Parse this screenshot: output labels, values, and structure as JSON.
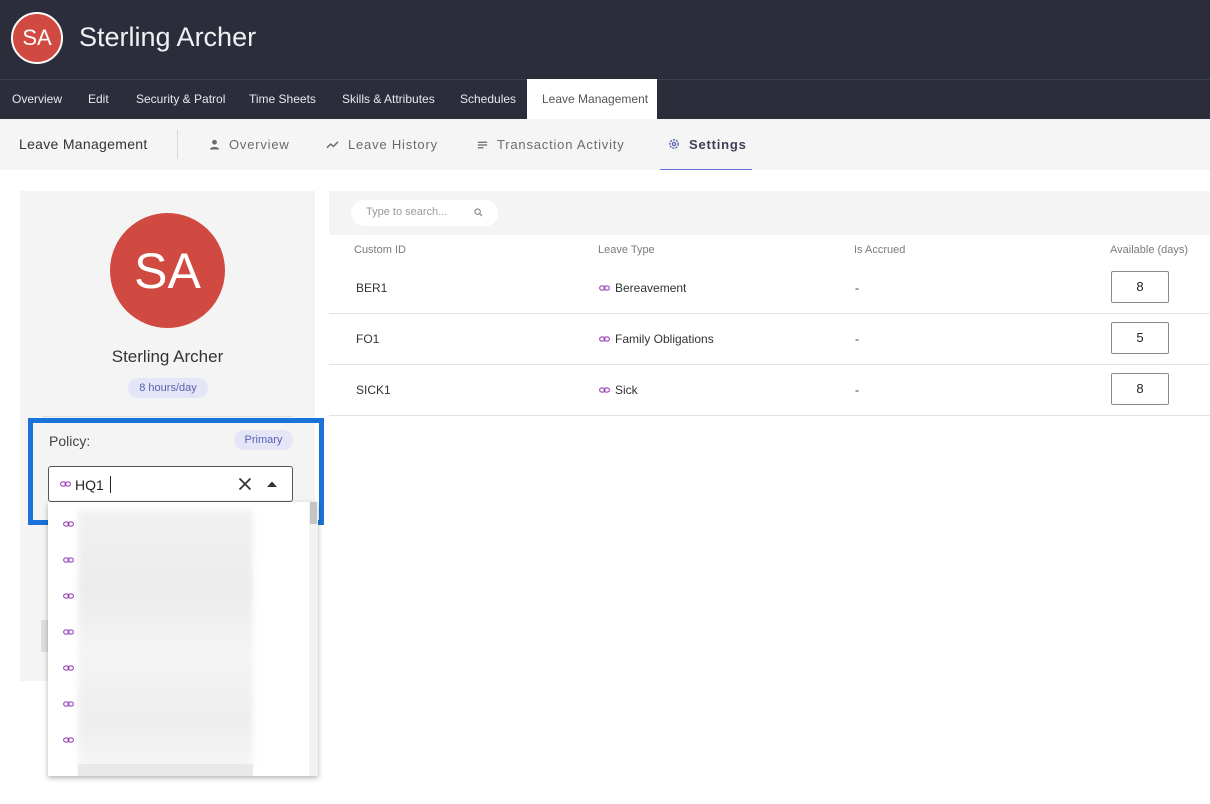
{
  "header": {
    "avatar_initials": "SA",
    "user_name": "Sterling Archer"
  },
  "tabs": [
    {
      "label": "Overview"
    },
    {
      "label": "Edit"
    },
    {
      "label": "Security & Patrol"
    },
    {
      "label": "Time Sheets"
    },
    {
      "label": "Skills & Attributes"
    },
    {
      "label": "Schedules"
    },
    {
      "label": "Leave Management",
      "active": true
    }
  ],
  "subnav": {
    "title": "Leave Management",
    "tabs": [
      {
        "label": "Overview",
        "icon": "person-icon"
      },
      {
        "label": "Leave History",
        "icon": "trend-icon"
      },
      {
        "label": "Transaction Activity",
        "icon": "notes-icon"
      },
      {
        "label": "Settings",
        "icon": "gear-icon",
        "active": true
      }
    ]
  },
  "profile": {
    "avatar_initials": "SA",
    "name": "Sterling Archer",
    "hours_badge": "8 hours/day",
    "policy_label": "Policy:",
    "primary_badge": "Primary",
    "policy_value": "HQ1"
  },
  "search": {
    "placeholder": "Type to search..."
  },
  "table": {
    "columns": [
      "Custom ID",
      "Leave Type",
      "Is Accrued",
      "Available (days)"
    ],
    "rows": [
      {
        "custom_id": "BER1",
        "leave_type": "Bereavement",
        "is_accrued": "-",
        "available": "8"
      },
      {
        "custom_id": "FO1",
        "leave_type": "Family Obligations",
        "is_accrued": "-",
        "available": "5"
      },
      {
        "custom_id": "SICK1",
        "leave_type": "Sick",
        "is_accrued": "-",
        "available": "8"
      }
    ]
  },
  "colors": {
    "header_bg": "#2b2d3b",
    "avatar_red": "#d14a41",
    "accent_purple": "#9c3fb8",
    "highlight_blue": "#1a73d9"
  }
}
